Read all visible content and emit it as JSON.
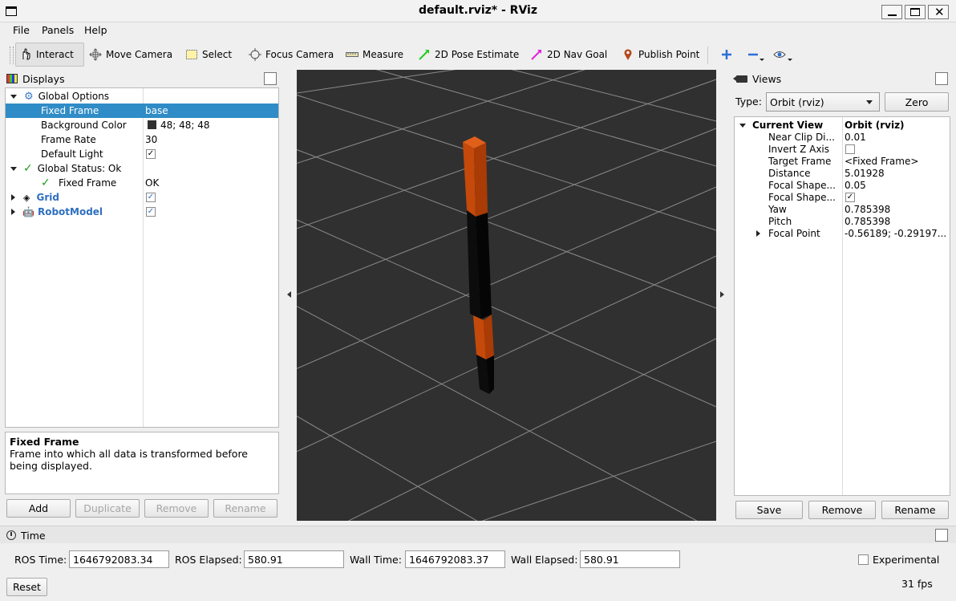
{
  "window": {
    "title": "default.rviz* - RViz"
  },
  "menubar": {
    "items": [
      "File",
      "Panels",
      "Help"
    ]
  },
  "toolbar": {
    "tools": [
      {
        "label": "Interact",
        "icon": "hand-pointer-icon"
      },
      {
        "label": "Move Camera",
        "icon": "move-camera-icon"
      },
      {
        "label": "Select",
        "icon": "select-box-icon"
      },
      {
        "label": "Focus Camera",
        "icon": "focus-camera-icon"
      },
      {
        "label": "Measure",
        "icon": "ruler-icon"
      },
      {
        "label": "2D Pose Estimate",
        "icon": "pose-arrow-icon"
      },
      {
        "label": "2D Nav Goal",
        "icon": "nav-goal-arrow-icon"
      },
      {
        "label": "Publish Point",
        "icon": "map-pin-icon"
      }
    ],
    "colors": {
      "pose_arrow": "#22cc22",
      "nav_arrow": "#e020e0",
      "pin": "#b5491c",
      "plus_minus": "#2a6fd6"
    }
  },
  "displays": {
    "title": "Displays",
    "rows": [
      {
        "name": "Global Options",
        "value": ""
      },
      {
        "name": "Fixed Frame",
        "value": "base"
      },
      {
        "name": "Background Color",
        "value": "48; 48; 48"
      },
      {
        "name": "Frame Rate",
        "value": "30"
      },
      {
        "name": "Default Light",
        "value": ""
      },
      {
        "name": "Global Status: Ok",
        "value": ""
      },
      {
        "name": "Fixed Frame",
        "value": "OK"
      },
      {
        "name": "Grid",
        "value": ""
      },
      {
        "name": "RobotModel",
        "value": ""
      }
    ],
    "description": {
      "title": "Fixed Frame",
      "text": "Frame into which all data is transformed before being displayed."
    },
    "buttons": {
      "add": "Add",
      "duplicate": "Duplicate",
      "remove": "Remove",
      "rename": "Rename"
    }
  },
  "viewport": {
    "background": "#303030",
    "grid_color": "#a0a0a0",
    "robot_orange": "#c4490b",
    "robot_black": "#0a0a0a"
  },
  "views": {
    "title": "Views",
    "type_label": "Type:",
    "type_value": "Orbit (rviz)",
    "zero": "Zero",
    "props": [
      {
        "name": "Current View",
        "value": "Orbit (rviz)"
      },
      {
        "name": "Near Clip Di...",
        "value": "0.01"
      },
      {
        "name": "Invert Z Axis",
        "value": ""
      },
      {
        "name": "Target Frame",
        "value": "<Fixed Frame>"
      },
      {
        "name": "Distance",
        "value": "5.01928"
      },
      {
        "name": "Focal Shape...",
        "value": "0.05"
      },
      {
        "name": "Focal Shape...",
        "value": ""
      },
      {
        "name": "Yaw",
        "value": "0.785398"
      },
      {
        "name": "Pitch",
        "value": "0.785398"
      },
      {
        "name": "Focal Point",
        "value": "-0.56189; -0.29197..."
      }
    ],
    "buttons": {
      "save": "Save",
      "remove": "Remove",
      "rename": "Rename"
    }
  },
  "time": {
    "title": "Time",
    "ros_time_label": "ROS Time:",
    "ros_time": "1646792083.34",
    "ros_elapsed_label": "ROS Elapsed:",
    "ros_elapsed": "580.91",
    "wall_time_label": "Wall Time:",
    "wall_time": "1646792083.37",
    "wall_elapsed_label": "Wall Elapsed:",
    "wall_elapsed": "580.91",
    "experimental": "Experimental",
    "reset": "Reset",
    "fps": "31 fps"
  }
}
